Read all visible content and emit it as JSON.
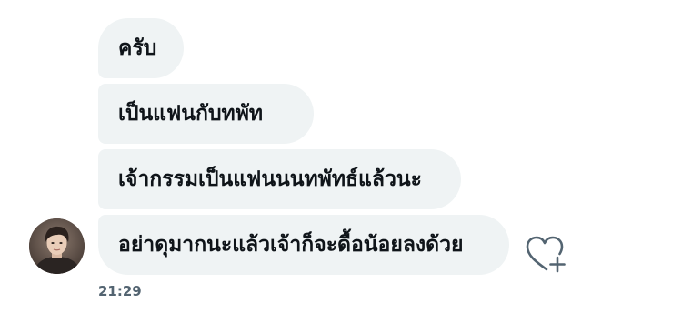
{
  "conversation": {
    "messages": [
      {
        "text": "ครับ"
      },
      {
        "text": "เป็นแฟนกับทพัท"
      },
      {
        "text": "เจ้ากรรมเป็นแฟนนนทพัทธ์แล้วนะ"
      },
      {
        "text": "อย่าดุมากนะแล้วเจ้าก็จะดื้อน้อยลงด้วย"
      }
    ],
    "timestamp": "21:29"
  },
  "icons": {
    "like": "heart-plus-icon",
    "avatar": "user-avatar"
  },
  "colors": {
    "bubble": "#eff3f4",
    "text": "#0f1419",
    "muted": "#536471",
    "icon": "#536471"
  }
}
